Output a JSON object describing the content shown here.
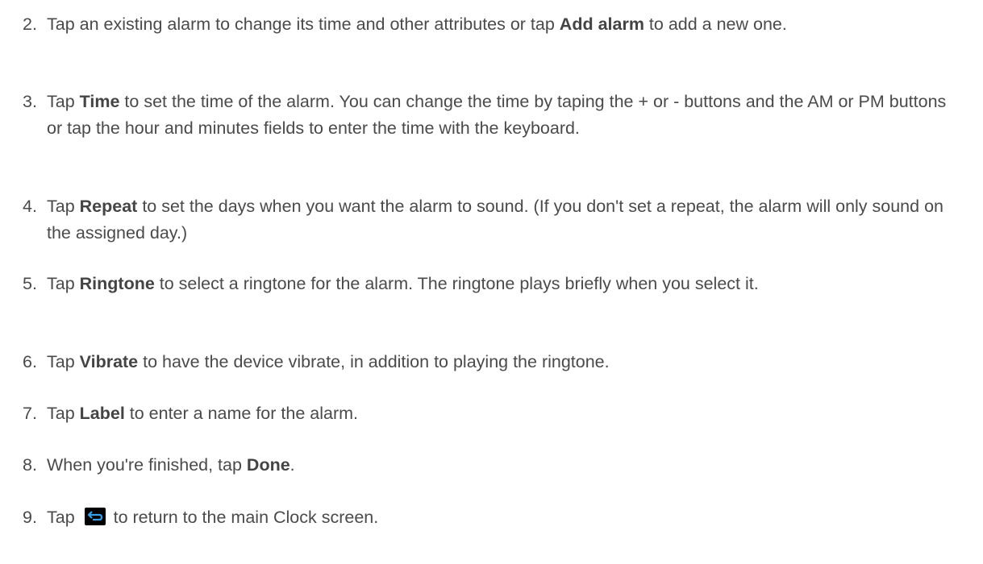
{
  "steps": [
    {
      "num": "2.",
      "pre": "Tap an existing alarm to change its time and other attributes or tap ",
      "bold": "Add alarm",
      "post": " to add a new one."
    },
    {
      "num": "3.",
      "pre": "Tap ",
      "bold": "Time",
      "post": " to set the time of the alarm. You can change the time by taping the + or - buttons and the AM or PM buttons or tap the hour and minutes fields to enter the time with the keyboard."
    },
    {
      "num": "4.",
      "pre": "Tap ",
      "bold": "Repeat",
      "post": " to set the days when you want the alarm to sound. (If you don't set a repeat, the alarm will only sound on the assigned day.)"
    },
    {
      "num": "5.",
      "pre": "Tap ",
      "bold": "Ringtone",
      "post": " to select a ringtone for the alarm. The ringtone plays briefly when you select it."
    },
    {
      "num": "6.",
      "pre": "Tap ",
      "bold": "Vibrate",
      "post": " to have the device vibrate, in addition to playing the ringtone."
    },
    {
      "num": "7.",
      "pre": "Tap ",
      "bold": "Label",
      "post": " to enter a name for the alarm."
    },
    {
      "num": "8.",
      "pre": "When you're finished, tap ",
      "bold": "Done",
      "post": "."
    },
    {
      "num": "9.",
      "pre": "Tap ",
      "icon": "back-icon",
      "post": " to return to the main Clock screen."
    }
  ]
}
